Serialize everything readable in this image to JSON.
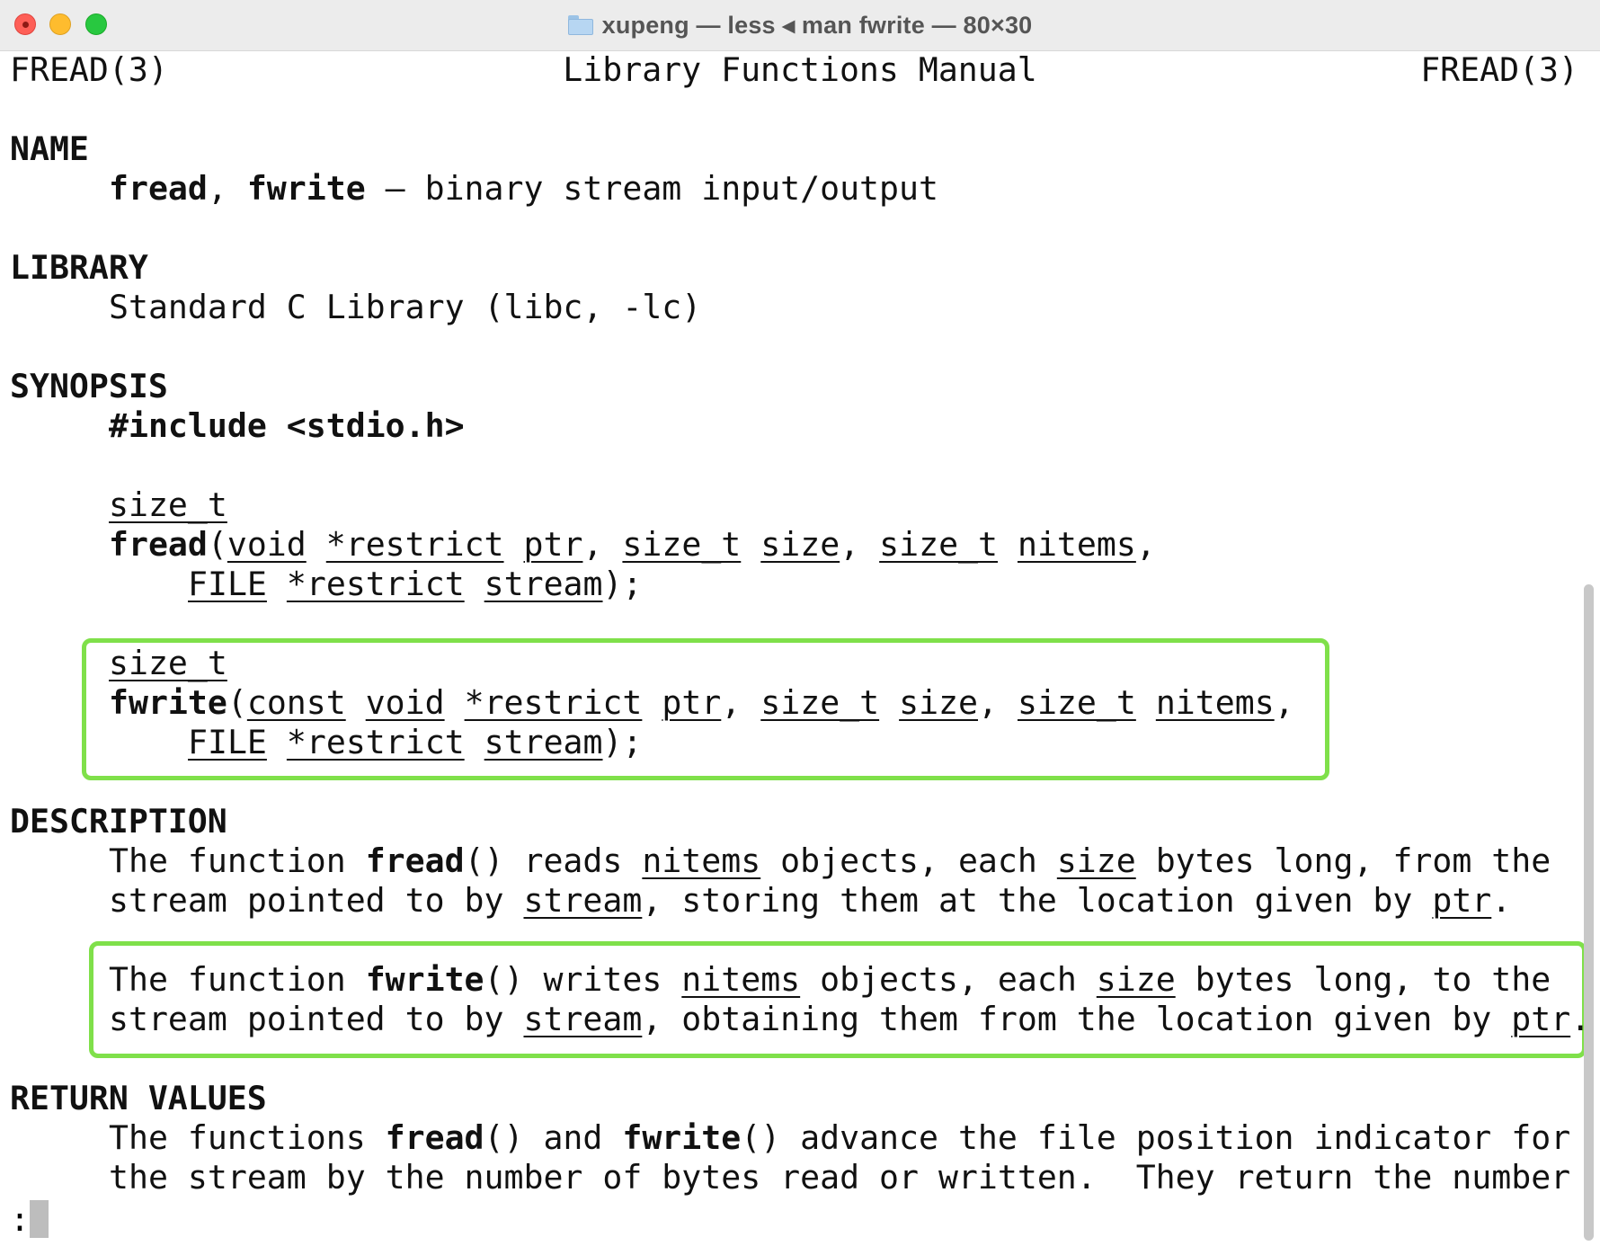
{
  "window": {
    "title": "xupeng — less ◂ man fwrite — 80×30"
  },
  "man": {
    "header_left": "FREAD(3)",
    "header_center": "Library Functions Manual",
    "header_right": "FREAD(3)",
    "name_heading": "NAME",
    "name_fn1": "fread",
    "name_sep": ", ",
    "name_fn2": "fwrite",
    "name_desc": " — binary stream input/output",
    "library_heading": "LIBRARY",
    "library_text": "Standard C Library (libc, -lc)",
    "synopsis_heading": "SYNOPSIS",
    "include": "#include <stdio.h>",
    "type_size_t": "size_t",
    "fread_name": "fread",
    "fwrite_name": "fwrite",
    "p_open": "(",
    "kw_const": "const",
    "kw_void": "void",
    "kw_restrict": "*restrict",
    "kw_ptr": "ptr",
    "kw_size_t": "size_t",
    "kw_size": "size",
    "kw_nitems": "nitems",
    "kw_file": "FILE",
    "kw_stream": "stream",
    "comma": ",",
    "close_paren": ");",
    "description_heading": "DESCRIPTION",
    "desc1_a": "The function ",
    "desc1_fn": "fread",
    "desc1_b": "() reads ",
    "desc1_c": " objects, each ",
    "desc1_d": " bytes long, from the",
    "desc1_line2_a": "stream pointed to by ",
    "desc1_line2_b": ", storing them at the location given by ",
    "period": ".",
    "desc2_a": "The function ",
    "desc2_fn": "fwrite",
    "desc2_b": "() writes ",
    "desc2_c": " objects, each ",
    "desc2_d": " bytes long, to the",
    "desc2_line2_a": "stream pointed to by ",
    "desc2_line2_b": ", obtaining them from the location given by ",
    "return_heading": "RETURN VALUES",
    "ret_a": "The functions ",
    "ret_fn1": "fread",
    "ret_b": "() and ",
    "ret_fn2": "fwrite",
    "ret_c": "() advance the file position indicator for",
    "ret_line2": "the stream by the number of bytes read or written.  They return the number",
    "prompt": ":"
  },
  "colors": {
    "highlight": "#7fe04a"
  }
}
